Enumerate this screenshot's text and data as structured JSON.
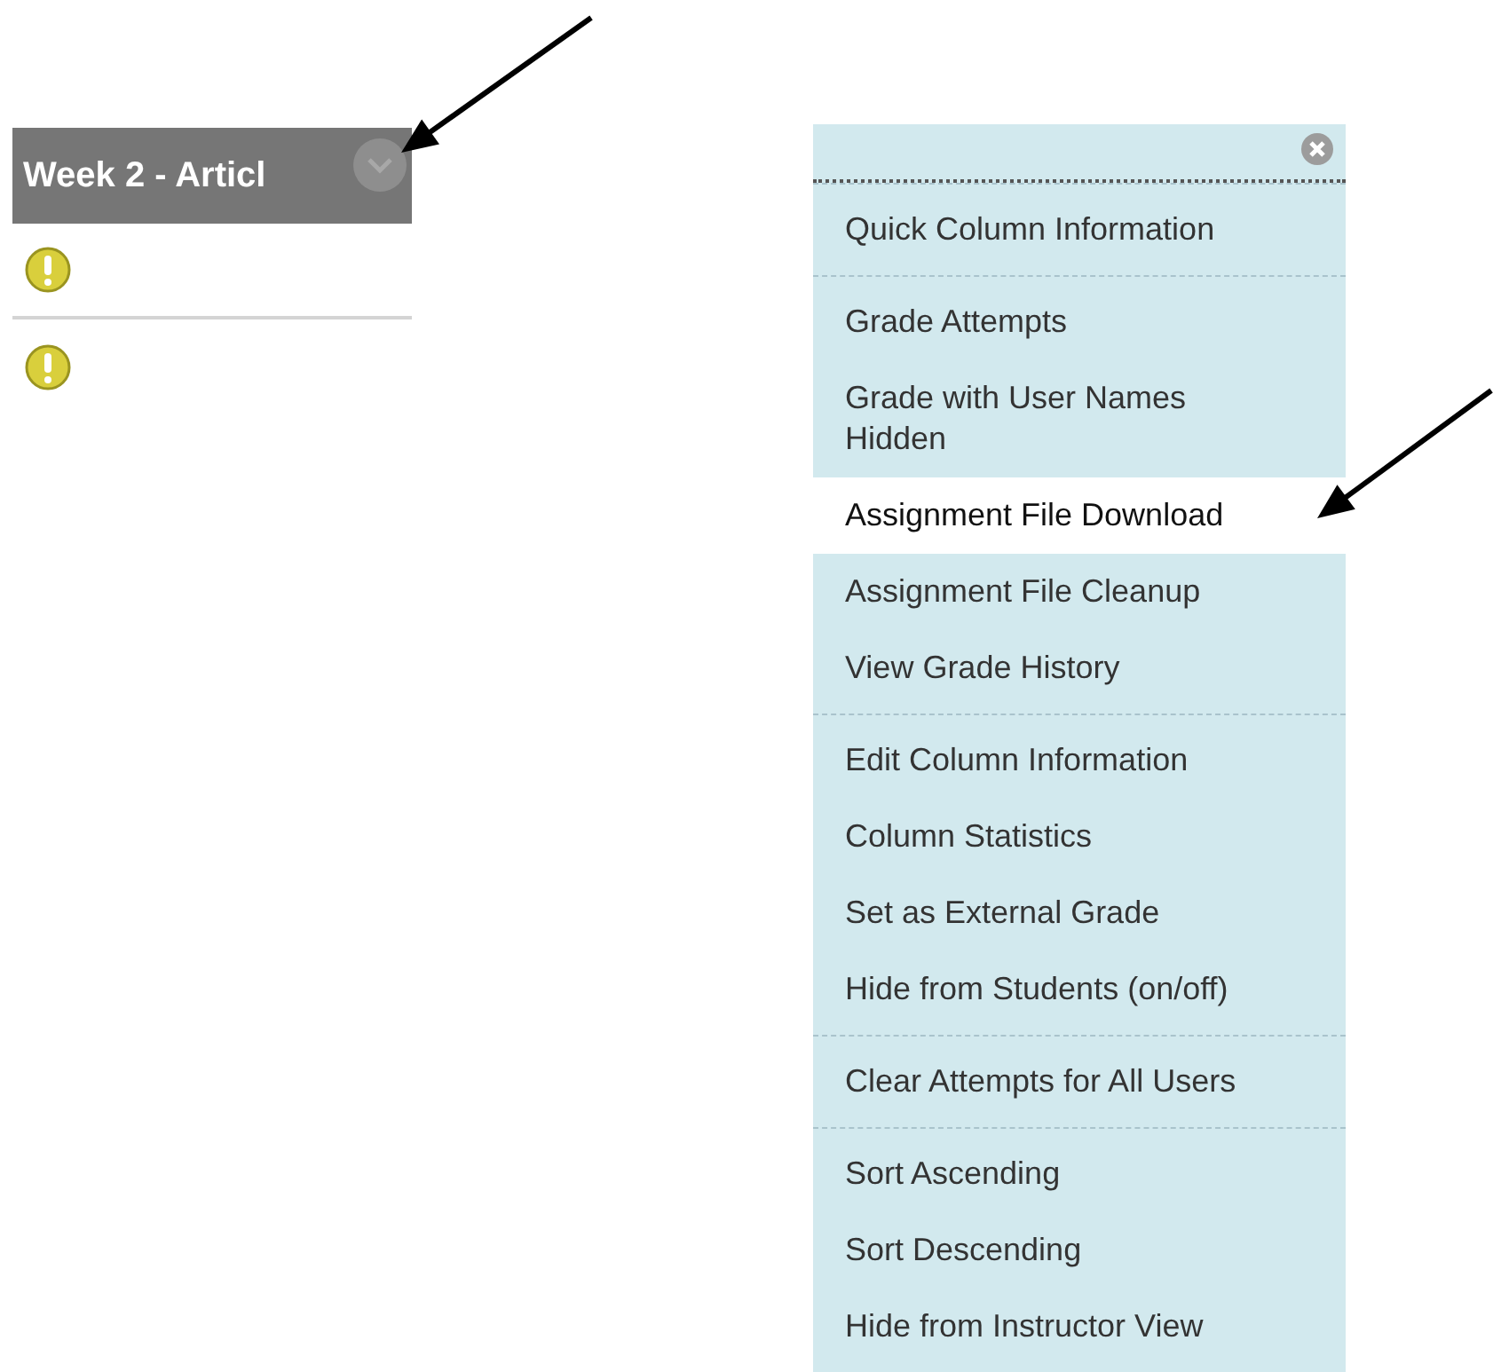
{
  "column_header": {
    "title": "Week 2 - Articl"
  },
  "rows": [
    {
      "kind": "needs-grading"
    },
    {
      "kind": "needs-grading"
    }
  ],
  "menu": {
    "groups": [
      [
        {
          "label": "Quick Column Information",
          "selected": false
        }
      ],
      [
        {
          "label": "Grade Attempts",
          "selected": false
        },
        {
          "label": "Grade with User Names Hidden",
          "selected": false
        },
        {
          "label": "Assignment File Download",
          "selected": true
        },
        {
          "label": "Assignment File Cleanup",
          "selected": false
        },
        {
          "label": "View Grade History",
          "selected": false
        }
      ],
      [
        {
          "label": "Edit Column Information",
          "selected": false
        },
        {
          "label": "Column Statistics",
          "selected": false
        },
        {
          "label": "Set as External Grade",
          "selected": false
        },
        {
          "label": "Hide from Students (on/off)",
          "selected": false
        }
      ],
      [
        {
          "label": "Clear Attempts for All Users",
          "selected": false
        }
      ],
      [
        {
          "label": "Sort Ascending",
          "selected": false
        },
        {
          "label": "Sort Descending",
          "selected": false
        },
        {
          "label": "Hide from Instructor View",
          "selected": false
        }
      ]
    ]
  }
}
